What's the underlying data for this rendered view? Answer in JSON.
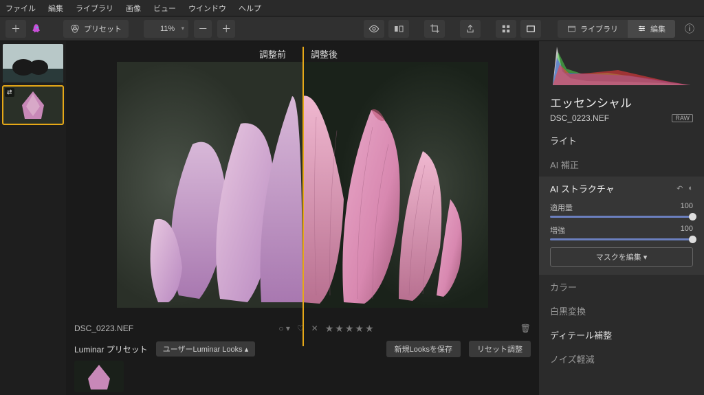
{
  "menu": [
    "ファイル",
    "編集",
    "ライブラリ",
    "画像",
    "ビュー",
    "ウインドウ",
    "ヘルプ"
  ],
  "toolbar": {
    "preset_label": "プリセット",
    "zoom": "11%",
    "mode_library": "ライブラリ",
    "mode_edit": "編集"
  },
  "preview": {
    "before": "調整前",
    "after": "調整後"
  },
  "info": {
    "filename": "DSC_0223.NEF",
    "flag": "○ ▾",
    "reject": "✕",
    "stars": "★★★★★"
  },
  "preset_bar": {
    "label": "Luminar プリセット",
    "dropdown": "ユーザーLuminar Looks ▴",
    "save_btn": "新規Looksを保存",
    "reset_btn": "リセット調整"
  },
  "right": {
    "panel_title": "エッセンシャル",
    "filename": "DSC_0223.NEF",
    "raw": "RAW",
    "tools": {
      "light": "ライト",
      "ai_correction": "AI 補正",
      "ai_structure": {
        "title": "AI ストラクチャ",
        "amount_label": "適用量",
        "amount_value": "100",
        "enhance_label": "増強",
        "enhance_value": "100",
        "mask_btn": "マスクを編集 ▾"
      },
      "color": "カラー",
      "bw": "白黒変換",
      "detail": "ディテール補整",
      "noise": "ノイズ軽減"
    }
  }
}
